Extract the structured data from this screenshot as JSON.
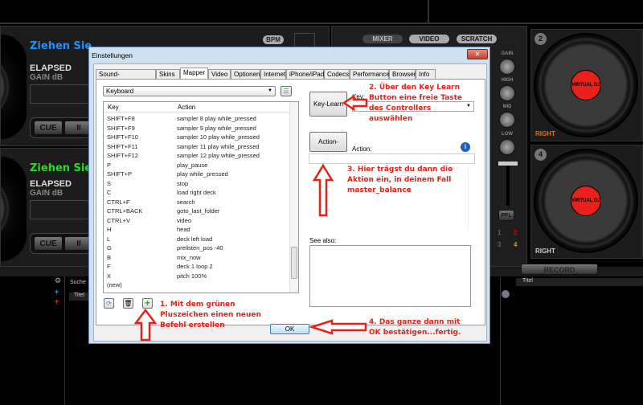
{
  "app": {
    "deck1": {
      "title": "Ziehen Sie",
      "elapsed": "ELAPSED",
      "gain": "GAIN dB",
      "cue": "CUE",
      "pause": "II",
      "color": "#1e90ff"
    },
    "deck3": {
      "title": "Ziehen Sie",
      "elapsed": "ELAPSED",
      "gain": "GAIN dB",
      "cue": "CUE",
      "pause": "II",
      "color": "#22dd22"
    },
    "bpm": "BPM",
    "modes": [
      "MIXER",
      "VIDEO",
      "SCRATCH"
    ],
    "mixer": {
      "knobs": [
        "GAIN",
        "HIGH",
        "MID",
        "LOW"
      ],
      "pfl": "PFL",
      "deck_nums": [
        "1",
        "2",
        "3",
        "4"
      ]
    },
    "deck2": {
      "number": "2",
      "side": "RIGHT",
      "label": "VIRTUAL DJ"
    },
    "deck4": {
      "number": "4",
      "side": "RIGHT",
      "label": "VIRTUAL DJ"
    },
    "record": "RECORD",
    "browser": {
      "search": "Suche",
      "col_left": "Titel",
      "col_right": "Titel"
    }
  },
  "dialog": {
    "title": "Einstellungen",
    "close": "✕",
    "tabs": [
      "Sound-Einstellungen",
      "Skins",
      "Mapper",
      "Video",
      "Optionen",
      "Internet",
      "iPhone/iPad",
      "Codecs",
      "Performance",
      "Browser",
      "Info"
    ],
    "active_tab": "Mapper",
    "device": "Keyboard",
    "columns": {
      "key": "Key",
      "action": "Action"
    },
    "rows": [
      [
        "SHIFT+F8",
        "sampler 8 play while_pressed"
      ],
      [
        "SHIFT+F9",
        "sampler 9 play while_pressed"
      ],
      [
        "SHIFT+F10",
        "sampler 10 play while_pressed"
      ],
      [
        "SHIFT+F11",
        "sampler 11 play while_pressed"
      ],
      [
        "SHIFT+F12",
        "sampler 12 play while_pressed"
      ],
      [
        "P",
        "play_pause"
      ],
      [
        "SHIFT+P",
        "play while_pressed"
      ],
      [
        "S",
        "stop"
      ],
      [
        "C",
        "load right deck"
      ],
      [
        "CTRL+F",
        "search"
      ],
      [
        "CTRL+BACK",
        "goto_last_folder"
      ],
      [
        "CTRL+V",
        "video"
      ],
      [
        "H",
        "head"
      ],
      [
        "L",
        "deck left load"
      ],
      [
        "G",
        "prelisten_pos -40"
      ],
      [
        "B",
        "mix_now"
      ],
      [
        "F",
        "deck 1 loop 2"
      ],
      [
        "X",
        "pitch 100%"
      ],
      [
        "(new)",
        ""
      ]
    ],
    "key_learn": "Key-Learn",
    "key_label": "Key:",
    "key_value": "",
    "action_learn": "Action-Learn",
    "action_label": "Action:",
    "action_value": "",
    "see_also": "See also:",
    "ok": "OK"
  },
  "annotations": {
    "step1": [
      "1. Mit dem grünen",
      "Pluszeichen einen neuen",
      "Befehl erstellen"
    ],
    "step2": [
      "2. Über den Key Learn",
      "Button eine freie Taste",
      "des Controllers",
      "auswählen"
    ],
    "step3": [
      "3. Hier trägst du dann die",
      "Aktion ein, in deinem Fall",
      "master_balance"
    ],
    "step4": [
      "4. Das ganze dann mit",
      "OK bestätigen...fertig."
    ],
    "color": "#e2231a"
  }
}
